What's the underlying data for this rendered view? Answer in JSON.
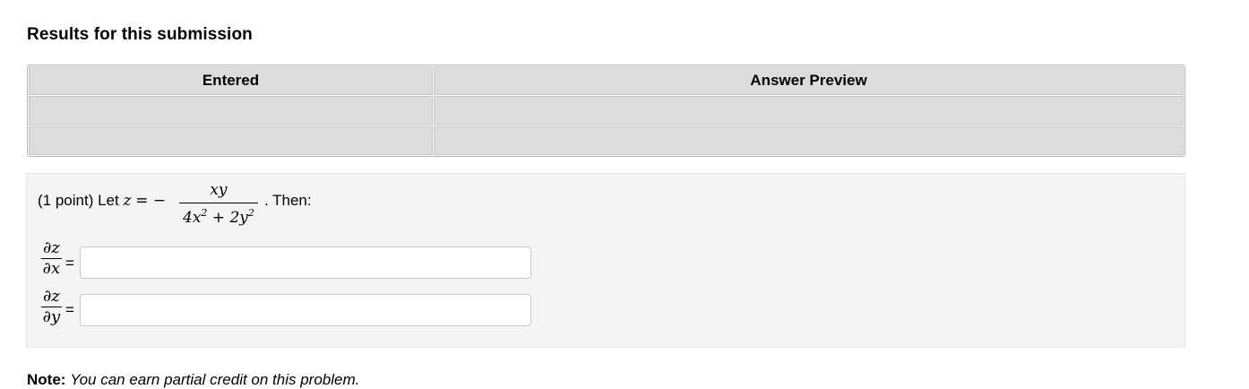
{
  "heading": "Results for this submission",
  "results_table": {
    "headers": [
      "Entered",
      "Answer Preview"
    ],
    "rows": [
      [
        "",
        ""
      ],
      [
        "",
        ""
      ]
    ]
  },
  "problem": {
    "points": "(1 point) Let",
    "var": "z",
    "eq": "= −",
    "numerator": "xy",
    "den_part1": "4x",
    "den_sup1": "2",
    "den_part2": " + 2y",
    "den_sup2": "2",
    "then": ". Then:",
    "partials": [
      {
        "top": "∂z",
        "bottom": "∂x",
        "equals": "=",
        "value": "",
        "placeholder": ""
      },
      {
        "top": "∂z",
        "bottom": "∂y",
        "equals": "=",
        "value": "",
        "placeholder": ""
      }
    ]
  },
  "note": {
    "label": "Note:",
    "text": "You can earn partial credit on this problem."
  }
}
